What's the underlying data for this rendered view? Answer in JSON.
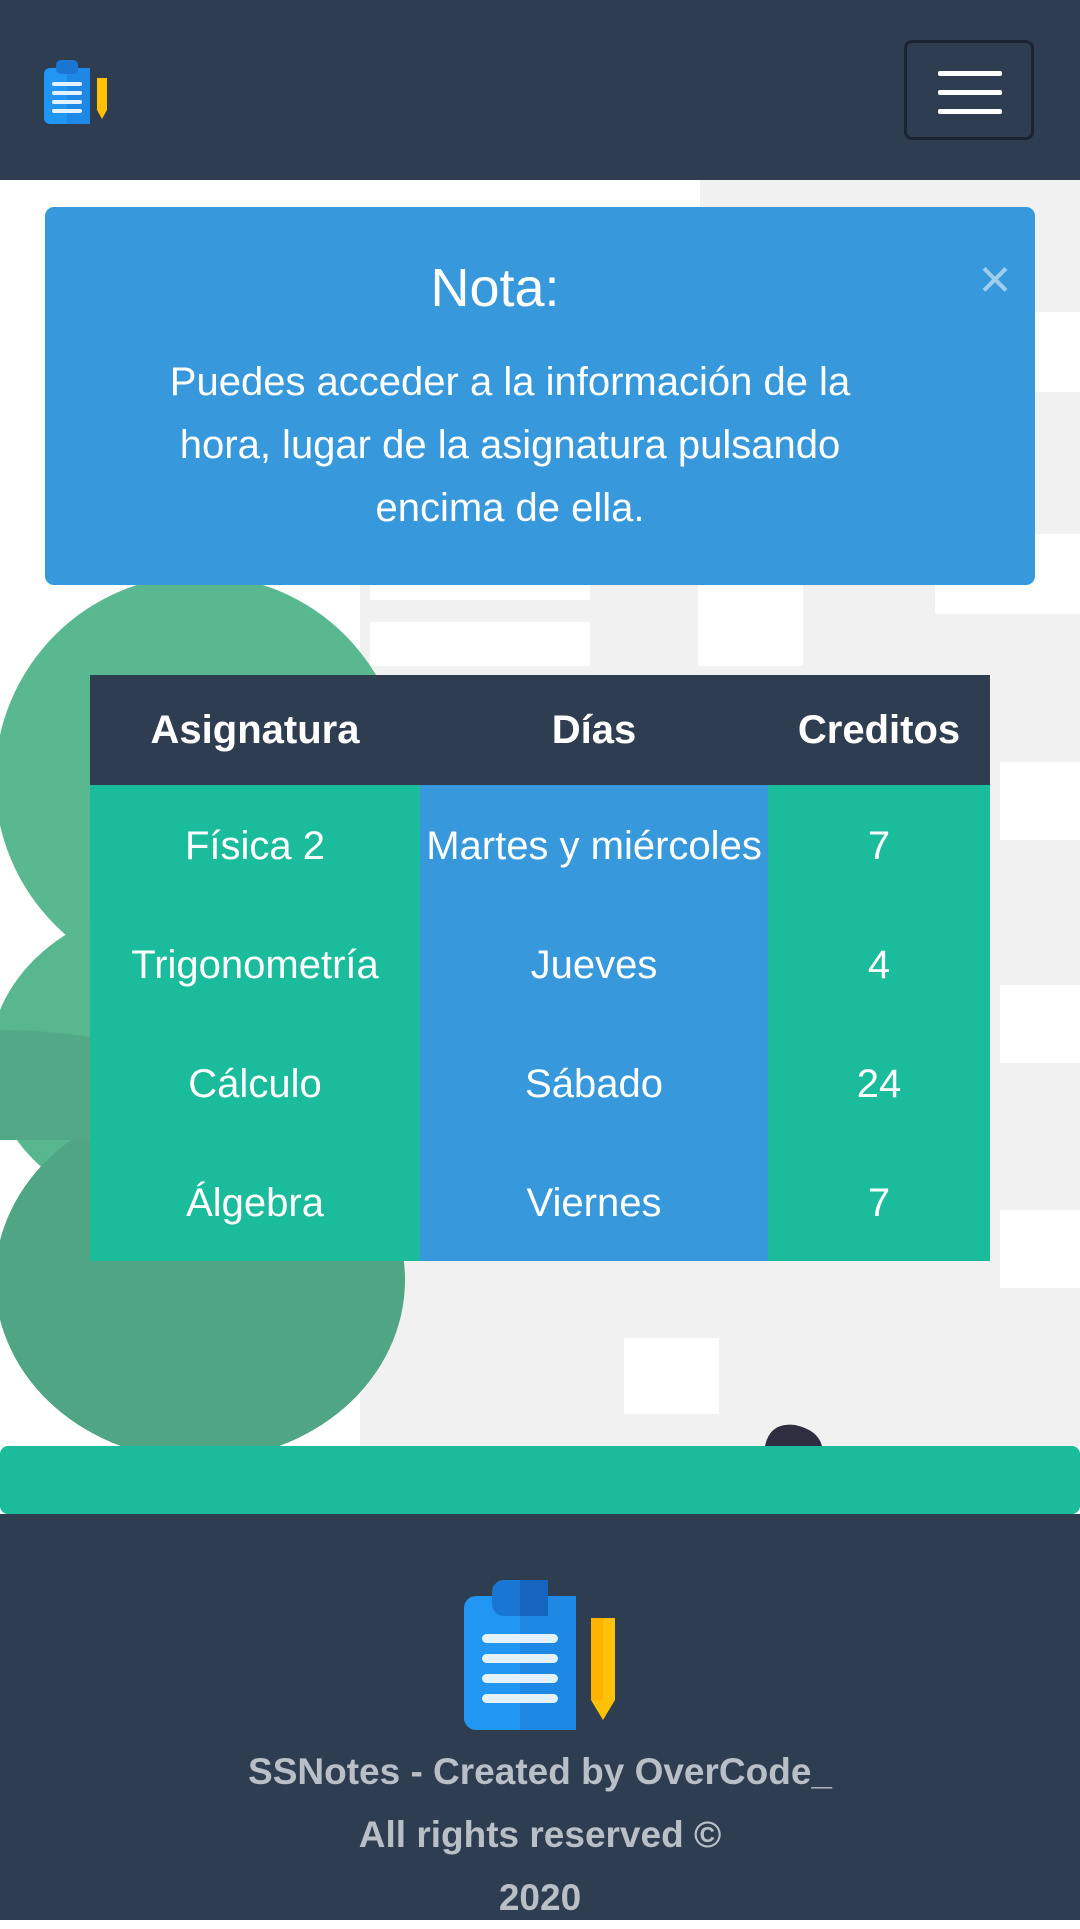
{
  "navbar": {
    "logo_icon": "clipboard-pencil-icon",
    "menu_icon": "hamburger-menu-icon"
  },
  "alert": {
    "title": "Nota:",
    "message": "Puedes acceder a la información de la hora, lugar de la asignatura pulsando encima de ella.",
    "close_label": "×"
  },
  "table": {
    "headers": [
      "Asignatura",
      "Días",
      "Creditos"
    ],
    "rows": [
      [
        "Física 2",
        "Martes y miércoles",
        "7"
      ],
      [
        "Trigonometría",
        "Jueves",
        "4"
      ],
      [
        "Cálculo",
        "Sábado",
        "24"
      ],
      [
        "Álgebra",
        "Viernes",
        "7"
      ]
    ]
  },
  "footer": {
    "logo_icon": "clipboard-pencil-icon",
    "line1": "SSNotes - Created by OverCode_",
    "line2": "All rights reserved ©",
    "line3": "2020"
  },
  "colors": {
    "navbar": "#2e3d50",
    "alert": "#3798db",
    "teal": "#1abc9c",
    "footer_text": "#b9bfc6"
  }
}
